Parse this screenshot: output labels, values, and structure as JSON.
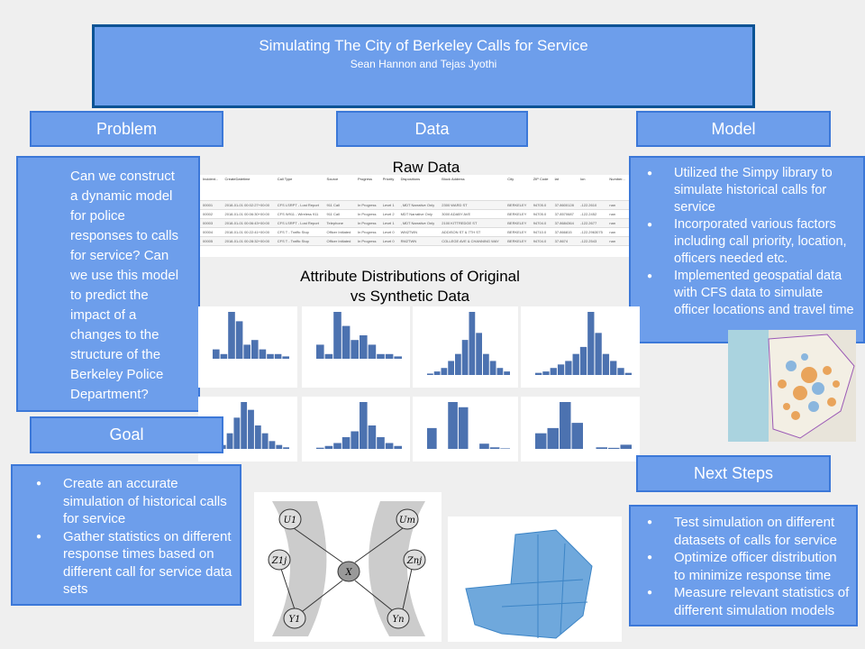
{
  "title": "Simulating The City of Berkeley Calls for Service",
  "authors": "Sean Hannon and Tejas Jyothi",
  "problem": {
    "header": "Problem",
    "text": "Can we construct a dynamic model for police responses to calls for service? Can we use this model to predict the impact of a changes to the structure of the Berkeley Police Department?"
  },
  "data": {
    "header": "Data",
    "raw_label": "Raw Data",
    "dist_label": "Attribute Distributions of Original vs Synthetic Data",
    "table": {
      "columns": [
        "Incident...",
        "CreateDatetime",
        "Call Type",
        "Source",
        "Progress",
        "Priority",
        "Dispositions",
        "Block Address",
        "City",
        "ZIP Code",
        "lat",
        "lon",
        "Number..."
      ],
      "rows": [
        [
          "00001",
          "2018-01-01 00:02:27+00:00",
          "CFS LSRPT - Lost Report",
          "911 Call",
          "In Progress",
          "Level 1",
          ", MDT Narrative Only",
          "2300 WARD ST",
          "BERKELEY",
          "94705.0",
          "37.8600128",
          "-122.2610",
          "nan"
        ],
        [
          "00002",
          "2018-01-01 00:06:30+00:00",
          "CFS W911 - Wireless 911",
          "911 Call",
          "In Progress",
          "Level 2",
          "MDT Narrative Only",
          "3000 ADABY AVE",
          "BERKELEY",
          "94705.0",
          "37.8570687",
          "-122.2452",
          "nan"
        ],
        [
          "00003",
          "2018-01-01 00:06:43+00:00",
          "CFS LSRPT - Lost Report",
          "Telephone",
          "In Progress",
          "Level 1",
          ", MDT Narrative Only",
          "2100 KITTREDGE ST",
          "BERKELEY",
          "94704.0",
          "37.8684364",
          "-122.2677",
          "nan"
        ],
        [
          "00004",
          "2018-01-01 00:22:41+00:00",
          "CFS T - Traffic Stop",
          "Officer Initiated",
          "In Progress",
          "Level 0",
          "WM2TWN",
          "ADDISON ST & 7TH ST",
          "BERKELEY",
          "94710.0",
          "37.866815",
          "-122.2963075",
          "nan"
        ],
        [
          "00005",
          "2018-01-01 00:28:32+00:00",
          "CFS T - Traffic Stop",
          "Officer Initiated",
          "In Progress",
          "Level 0",
          "RM2TWN",
          "COLLEGE AVE & CHANNING WAY",
          "BERKELEY",
          "94704.0",
          "37.8674",
          "-122.2543",
          "nan"
        ]
      ]
    }
  },
  "model": {
    "header": "Model",
    "bullets": [
      "Utilized the Simpy library to simulate historical calls for service",
      "Incorporated various factors including call priority, location, officers needed etc.",
      "Implemented geospatial data with CFS data to simulate officer locations and travel time"
    ]
  },
  "goal": {
    "header": "Goal",
    "bullets": [
      "Create an accurate simulation of historical calls for service",
      "Gather statistics on different response times based on different call for service data sets"
    ]
  },
  "next_steps": {
    "header": "Next Steps",
    "bullets": [
      "Test simulation on different datasets of calls for service",
      "Optimize officer distribution to minimize response time",
      "Measure relevant statistics of different simulation models"
    ]
  },
  "diagram": {
    "nodes": [
      "U1",
      "Um",
      "X",
      "Z1j",
      "Znj",
      "Y1",
      "Yn"
    ]
  },
  "colors": {
    "background": "#efefef",
    "box": "#6d9eeb",
    "border": "#3c78d8",
    "title_border": "#0b5394",
    "bars": "#4c72b0"
  }
}
